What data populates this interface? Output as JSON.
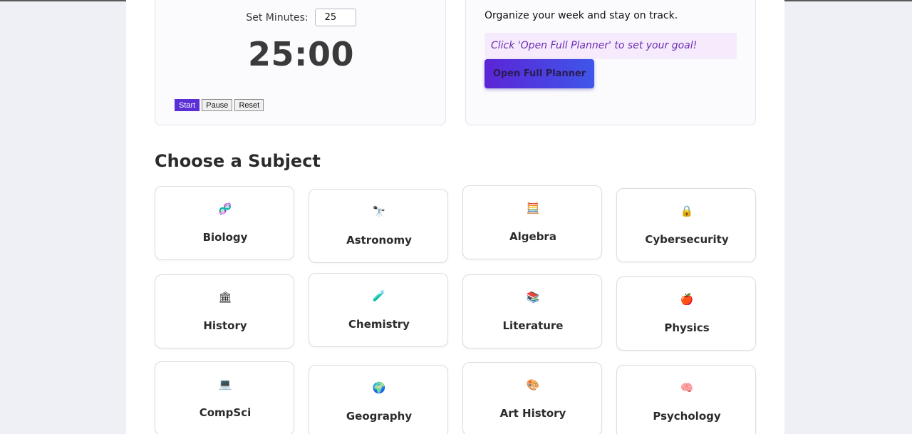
{
  "timer": {
    "set_label": "Set Minutes:",
    "minutes_value": "25",
    "display": "25:00",
    "start_label": "Start",
    "pause_label": "Pause",
    "reset_label": "Reset"
  },
  "planner": {
    "description": "Organize your week and stay on track.",
    "note": "Click 'Open Full Planner' to set your goal!",
    "button_label": "Open Full Planner"
  },
  "subjects_title": "Choose a Subject",
  "subjects": [
    {
      "name": "Biology",
      "icon": "🧬",
      "icon_name": "dna-icon"
    },
    {
      "name": "Astronomy",
      "icon": "🔭",
      "icon_name": "telescope-icon"
    },
    {
      "name": "Algebra",
      "icon": "🧮",
      "icon_name": "abacus-icon"
    },
    {
      "name": "Cybersecurity",
      "icon": "🔒",
      "icon_name": "lock-icon"
    },
    {
      "name": "History",
      "icon": "🏛",
      "icon_name": "classical-building-icon"
    },
    {
      "name": "Chemistry",
      "icon": "🧪",
      "icon_name": "test-tube-icon"
    },
    {
      "name": "Literature",
      "icon": "📚",
      "icon_name": "books-icon"
    },
    {
      "name": "Physics",
      "icon": "🍎",
      "icon_name": "apple-icon"
    },
    {
      "name": "CompSci",
      "icon": "💻",
      "icon_name": "laptop-icon"
    },
    {
      "name": "Geography",
      "icon": "🌍",
      "icon_name": "globe-icon"
    },
    {
      "name": "Art History",
      "icon": "🎨",
      "icon_name": "palette-icon"
    },
    {
      "name": "Psychology",
      "icon": "🧠",
      "icon_name": "brain-icon"
    }
  ],
  "colors": {
    "accent": "#5b25d6",
    "accent_end": "#3f56ea",
    "note_bg": "#f6ebfd",
    "note_text": "#6a2bb3"
  }
}
